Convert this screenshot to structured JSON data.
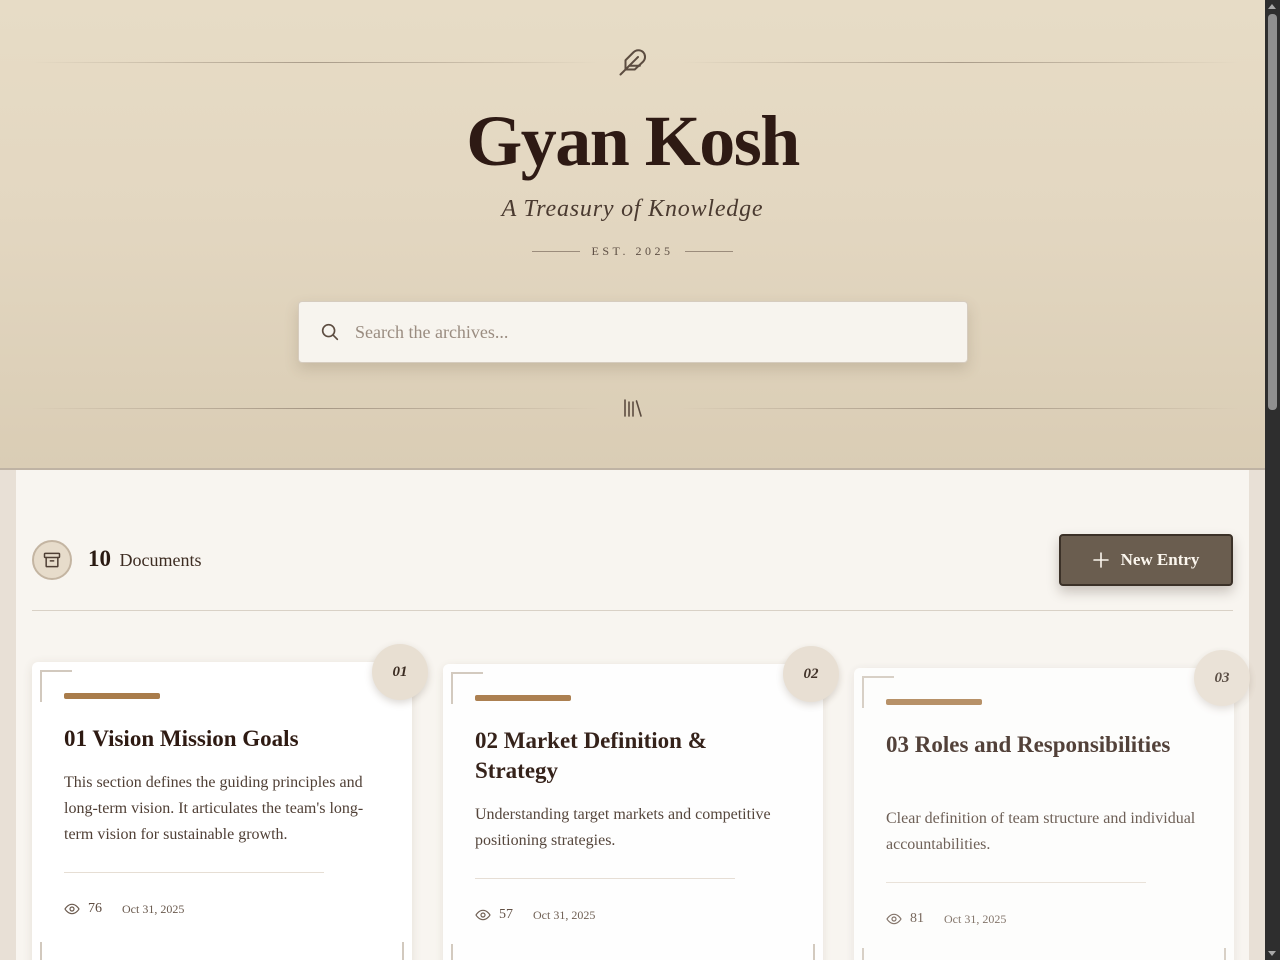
{
  "header": {
    "title": "Gyan Kosh",
    "subtitle": "A Treasury of Knowledge",
    "established": "EST. 2025",
    "icons": {
      "top": "feather-icon",
      "bottom": "library-icon"
    }
  },
  "search": {
    "placeholder": "Search the archives...",
    "value": ""
  },
  "toolbar": {
    "icon": "archive-icon",
    "count": "10",
    "count_label": "Documents",
    "new_entry_label": "New Entry"
  },
  "cards": [
    {
      "badge": "01",
      "title": "01 Vision Mission Goals",
      "description": "This section defines the guiding principles and long-term vision. It articulates the team's long-term vision for sustainable growth.",
      "views": "76",
      "date": "Oct 31, 2025"
    },
    {
      "badge": "02",
      "title": "02 Market Definition & Strategy",
      "description": "Understanding target markets and competitive positioning strategies.",
      "views": "57",
      "date": "Oct 31, 2025"
    },
    {
      "badge": "03",
      "title": "03 Roles and Responsibilities",
      "description": "Clear definition of team structure and individual accountabilities.",
      "views": "81",
      "date": "Oct 31, 2025"
    }
  ],
  "colors": {
    "accent": "#a97c4b",
    "button": "#6a5d4f",
    "title": "#2e1a14"
  }
}
